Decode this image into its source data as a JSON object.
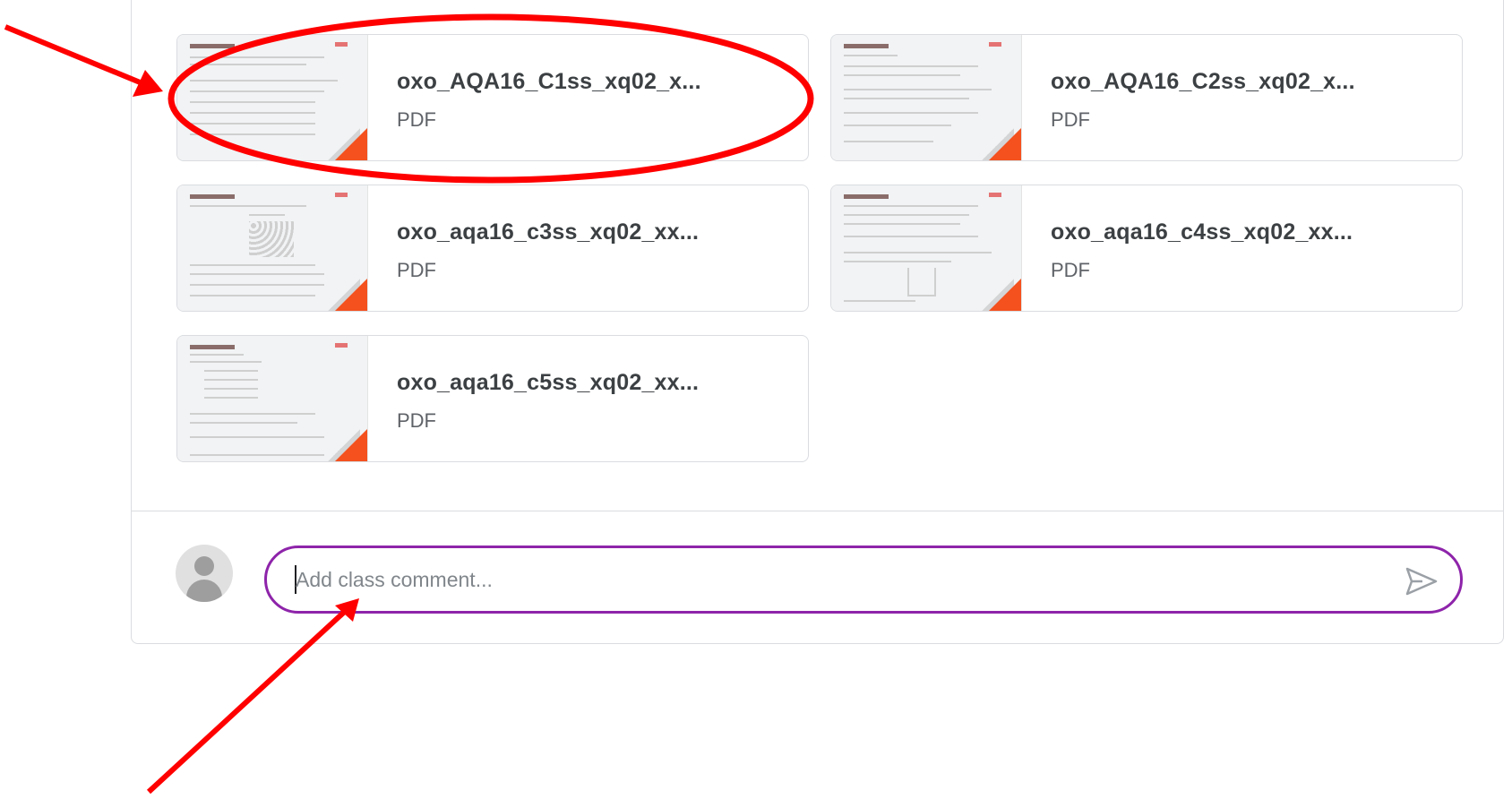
{
  "attachments": [
    {
      "title": "oxo_AQA16_C1ss_xq02_x...",
      "type": "PDF"
    },
    {
      "title": "oxo_AQA16_C2ss_xq02_x...",
      "type": "PDF"
    },
    {
      "title": "oxo_aqa16_c3ss_xq02_xx...",
      "type": "PDF"
    },
    {
      "title": "oxo_aqa16_c4ss_xq02_xx...",
      "type": "PDF"
    },
    {
      "title": "oxo_aqa16_c5ss_xq02_xx...",
      "type": "PDF"
    }
  ],
  "comment": {
    "placeholder": "Add class comment...",
    "value": ""
  },
  "icons": {
    "avatar": "person-avatar-icon",
    "send": "send-icon",
    "file": "pdf-thumbnail"
  },
  "colors": {
    "annotation": "#ff0000",
    "focus_border": "#8e24aa",
    "pdf_fold": "#f4511e"
  }
}
